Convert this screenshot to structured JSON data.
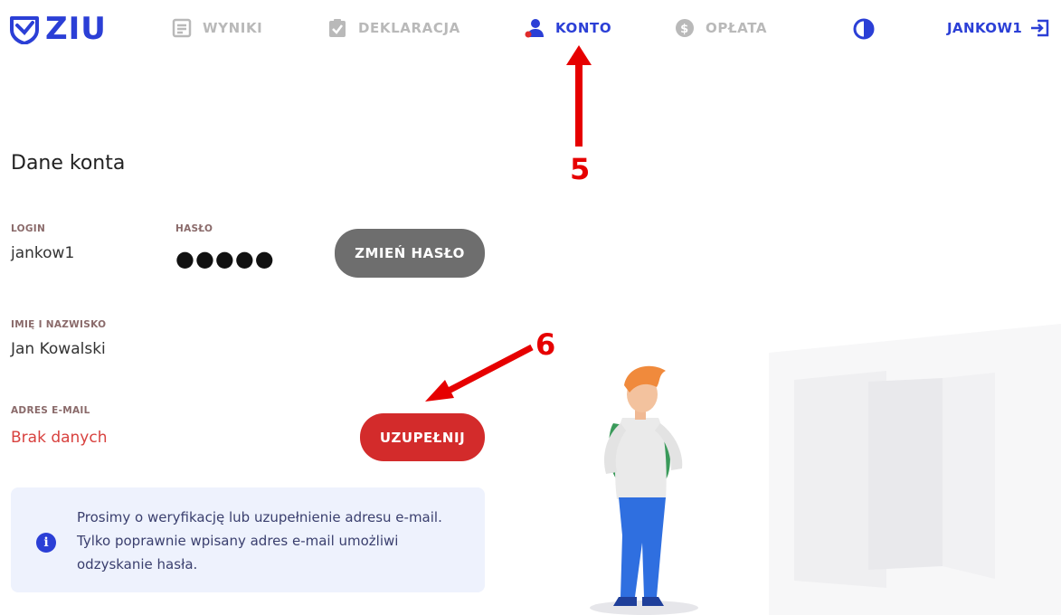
{
  "header": {
    "logo_text": "ZIU",
    "nav": [
      {
        "label": "WYNIKI",
        "icon": "results-list-icon"
      },
      {
        "label": "DEKLARACJA",
        "icon": "clipboard-check-icon"
      },
      {
        "label": "KONTO",
        "icon": "user-icon",
        "active": true
      },
      {
        "label": "OPŁATA",
        "icon": "dollar-coin-icon"
      }
    ],
    "contrast_icon": "contrast-icon",
    "username": "JANKOW1",
    "logout_icon": "logout-icon"
  },
  "account": {
    "title": "Dane konta",
    "login_label": "LOGIN",
    "login_value": "jankow1",
    "password_label": "HASŁO",
    "password_value": "●●●●●",
    "change_password_button": "ZMIEŃ HASŁO",
    "name_label": "IMIĘ I NAZWISKO",
    "name_value": "Jan Kowalski",
    "email_label": "ADRES E-MAIL",
    "email_value": "Brak danych",
    "fill_button": "UZUPEŁNIJ"
  },
  "info": {
    "icon": "info-icon",
    "text": "Prosimy o weryfikację lub uzupełnienie adresu e-mail. Tylko poprawnie wpisany adres e-mail umożliwi odzyskanie hasła."
  },
  "annotations": {
    "step5": "5",
    "step6": "6"
  },
  "colors": {
    "brand": "#2b3fd6",
    "inactive_nav": "#b9b9b9",
    "danger": "#d32b2b",
    "grey_button": "#6e6e6e",
    "annotation": "#e60000",
    "info_bg": "#eef2fd"
  }
}
